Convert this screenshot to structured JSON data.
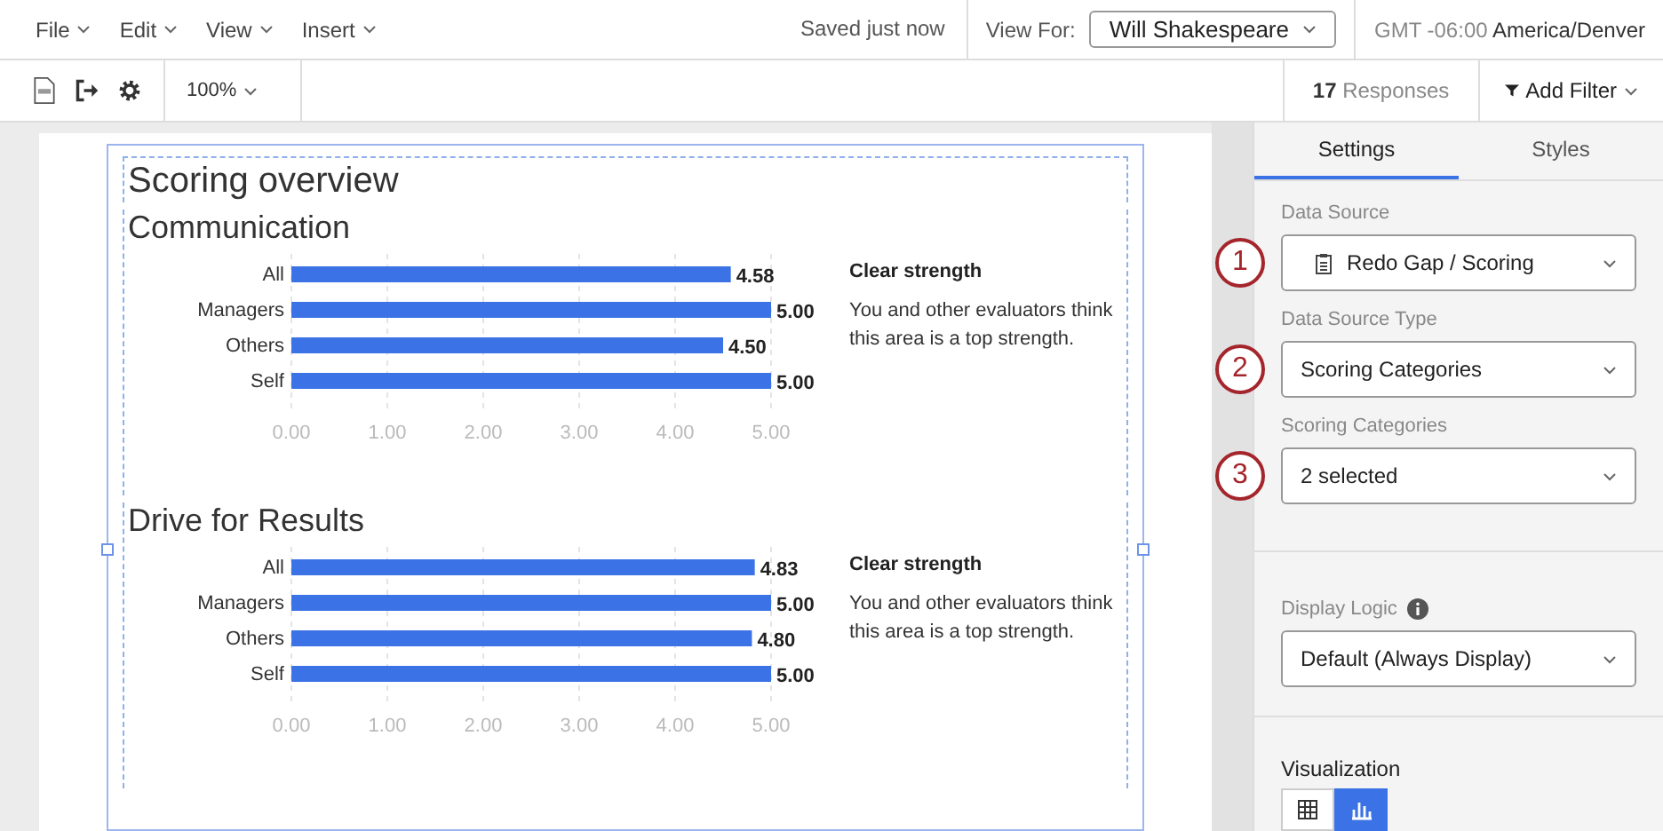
{
  "menu": [
    {
      "label": "File"
    },
    {
      "label": "Edit"
    },
    {
      "label": "View"
    },
    {
      "label": "Insert"
    }
  ],
  "save_status": "Saved just now",
  "view_for": {
    "label": "View For:",
    "value": "Will Shakespeare"
  },
  "timezone": {
    "offset": "GMT -06:00",
    "zone": "America/Denver"
  },
  "toolbar": {
    "zoom": "100%",
    "responses_count": "17",
    "responses_label": "Responses",
    "filter": "Add Filter"
  },
  "report": {
    "title": "Scoring overview",
    "sections": [
      {
        "heading": "Communication",
        "note_title": "Clear strength",
        "note_text": "You and other evaluators think this area is a top strength.",
        "chart_data": {
          "type": "bar",
          "orientation": "horizontal",
          "categories": [
            "All",
            "Managers",
            "Others",
            "Self"
          ],
          "series": [
            {
              "color": "#3b73e6",
              "values": [
                4.58,
                5.0,
                4.5,
                5.0
              ]
            }
          ],
          "xlim": [
            0,
            5
          ],
          "xticks": [
            {
              "value": 0,
              "label": "0.00"
            },
            {
              "value": 1,
              "label": "1.00"
            },
            {
              "value": 2,
              "label": "2.00"
            },
            {
              "value": 3,
              "label": "3.00"
            },
            {
              "value": 4,
              "label": "4.00"
            },
            {
              "value": 5,
              "label": "5.00"
            }
          ],
          "value_labels": [
            "4.58",
            "5.00",
            "4.50",
            "5.00"
          ],
          "grid": true
        }
      },
      {
        "heading": "Drive for Results",
        "note_title": "Clear strength",
        "note_text": "You and other evaluators think this area is a top strength.",
        "chart_data": {
          "type": "bar",
          "orientation": "horizontal",
          "categories": [
            "All",
            "Managers",
            "Others",
            "Self"
          ],
          "series": [
            {
              "color": "#3b73e6",
              "values": [
                4.83,
                5.0,
                4.8,
                5.0
              ]
            }
          ],
          "xlim": [
            0,
            5
          ],
          "xticks": [
            {
              "value": 0,
              "label": "0.00"
            },
            {
              "value": 1,
              "label": "1.00"
            },
            {
              "value": 2,
              "label": "2.00"
            },
            {
              "value": 3,
              "label": "3.00"
            },
            {
              "value": 4,
              "label": "4.00"
            },
            {
              "value": 5,
              "label": "5.00"
            }
          ],
          "value_labels": [
            "4.83",
            "5.00",
            "4.80",
            "5.00"
          ],
          "grid": true
        }
      }
    ]
  },
  "panel": {
    "tabs": [
      {
        "label": "Settings",
        "selected": true
      },
      {
        "label": "Styles",
        "selected": false
      }
    ],
    "fields": [
      {
        "label": "Data Source",
        "value": "Redo Gap / Scoring",
        "callout": "1",
        "kind": "source"
      },
      {
        "label": "Data Source Type",
        "value": "Scoring Categories",
        "callout": "2",
        "kind": "plain"
      },
      {
        "label": "Scoring Categories",
        "value": "2 selected",
        "callout": "3",
        "kind": "plain"
      }
    ],
    "display_logic": {
      "label": "Display Logic",
      "value": "Default (Always Display)"
    },
    "visualization": {
      "label": "Visualization",
      "options": [
        {
          "kind": "table",
          "selected": false
        },
        {
          "kind": "bar",
          "selected": true
        }
      ]
    }
  }
}
